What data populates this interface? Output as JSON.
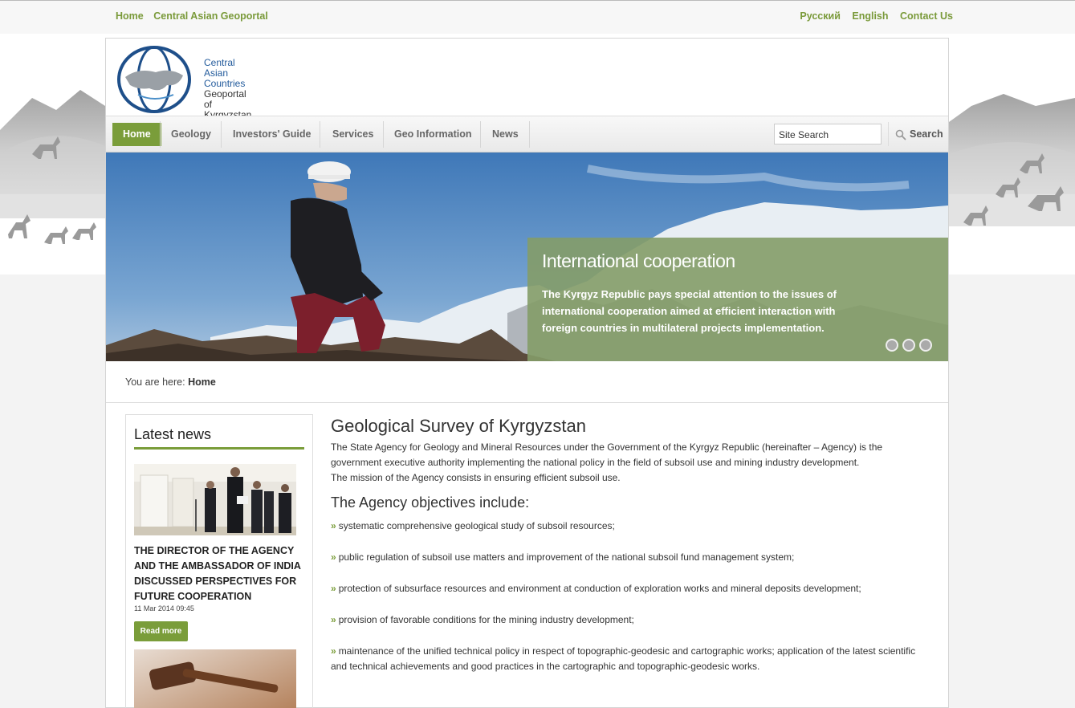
{
  "topbar": {
    "left_links": [
      "Home",
      "Central Asian Geoportal"
    ],
    "right_links": [
      "Русский",
      "English",
      "Contact Us"
    ]
  },
  "logo": {
    "line1": "Central",
    "line2": "Asian",
    "line3": "Countries",
    "line4": "Geoportal",
    "line5": "of Kyrgyzstan"
  },
  "nav": {
    "items": [
      "Home",
      "Geology",
      "Investors' Guide",
      "Services",
      "Geo Information",
      "News"
    ],
    "active": "Home"
  },
  "search": {
    "placeholder": "Site Search",
    "button_label": "Search"
  },
  "hero": {
    "title": "International cooperation",
    "text": "The Kyrgyz Republic pays special attention to the issues of international cooperation aimed at efficient interaction with foreign countries in multilateral projects implementation.",
    "slide_count": 3
  },
  "breadcrumb": {
    "prefix": "You are here:",
    "current": "Home"
  },
  "sidebar": {
    "title": "Latest news",
    "news": [
      {
        "title": "THE DIRECTOR OF THE AGENCY AND THE AMBASSADOR OF INDIA DISCUSSED PERSPECTIVES FOR FUTURE COOPERATION",
        "date": "11 Mar 2014 09:45",
        "read_more": "Read more"
      }
    ]
  },
  "main": {
    "title": "Geological Survey of Kyrgyzstan",
    "intro": "The State Agency for Geology and Mineral Resources under the Government of the Kyrgyz Republic (hereinafter – Agency) is the government executive authority implementing the national policy in the field of subsoil use and mining industry development.",
    "mission": "The mission of the Agency consists in ensuring efficient subsoil use.",
    "objectives_title": "The Agency objectives include:",
    "objectives": [
      "systematic comprehensive geological study of subsoil resources;",
      "public regulation of subsoil use matters and improvement of the national subsoil fund management system;",
      "protection of subsurface resources and environment at conduction of exploration works and mineral deposits development;",
      "provision of favorable conditions for the mining industry development;",
      "maintenance of the unified technical policy in respect of topographic-geodesic and cartographic works; application of the latest scientific and technical achievements and good practices in the cartographic and topographic-geodesic works."
    ]
  },
  "colors": {
    "accent": "#7a9d3a",
    "link": "#7a9a3a",
    "caption_bg": "#849c68"
  }
}
